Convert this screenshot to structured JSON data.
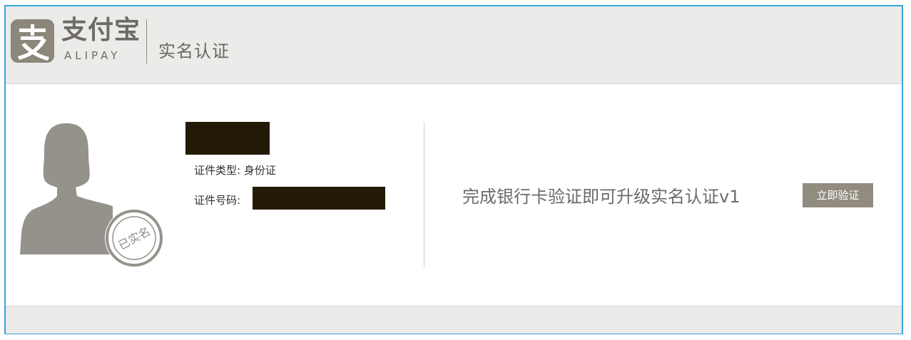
{
  "header": {
    "logo_cn": "支付宝",
    "logo_en": "ALIPAY",
    "logo_icon": "alipay-logo-icon",
    "title": "实名认证"
  },
  "profile": {
    "avatar_icon": "user-silhouette-icon",
    "seal_text": "已实名",
    "name_redacted": true,
    "id_type_label": "证件类型:",
    "id_type_value": "身份证",
    "id_number_label": "证件号码:",
    "id_number_redacted": true
  },
  "promo": {
    "text": "完成银行卡验证即可升级实名认证v1",
    "button_label": "立即验证"
  },
  "colors": {
    "frame_border": "#3aa3d8",
    "header_bg": "#ebebea",
    "logo_gray": "#8b877b",
    "button_bg": "#918c7f",
    "redaction": "#221a06"
  }
}
